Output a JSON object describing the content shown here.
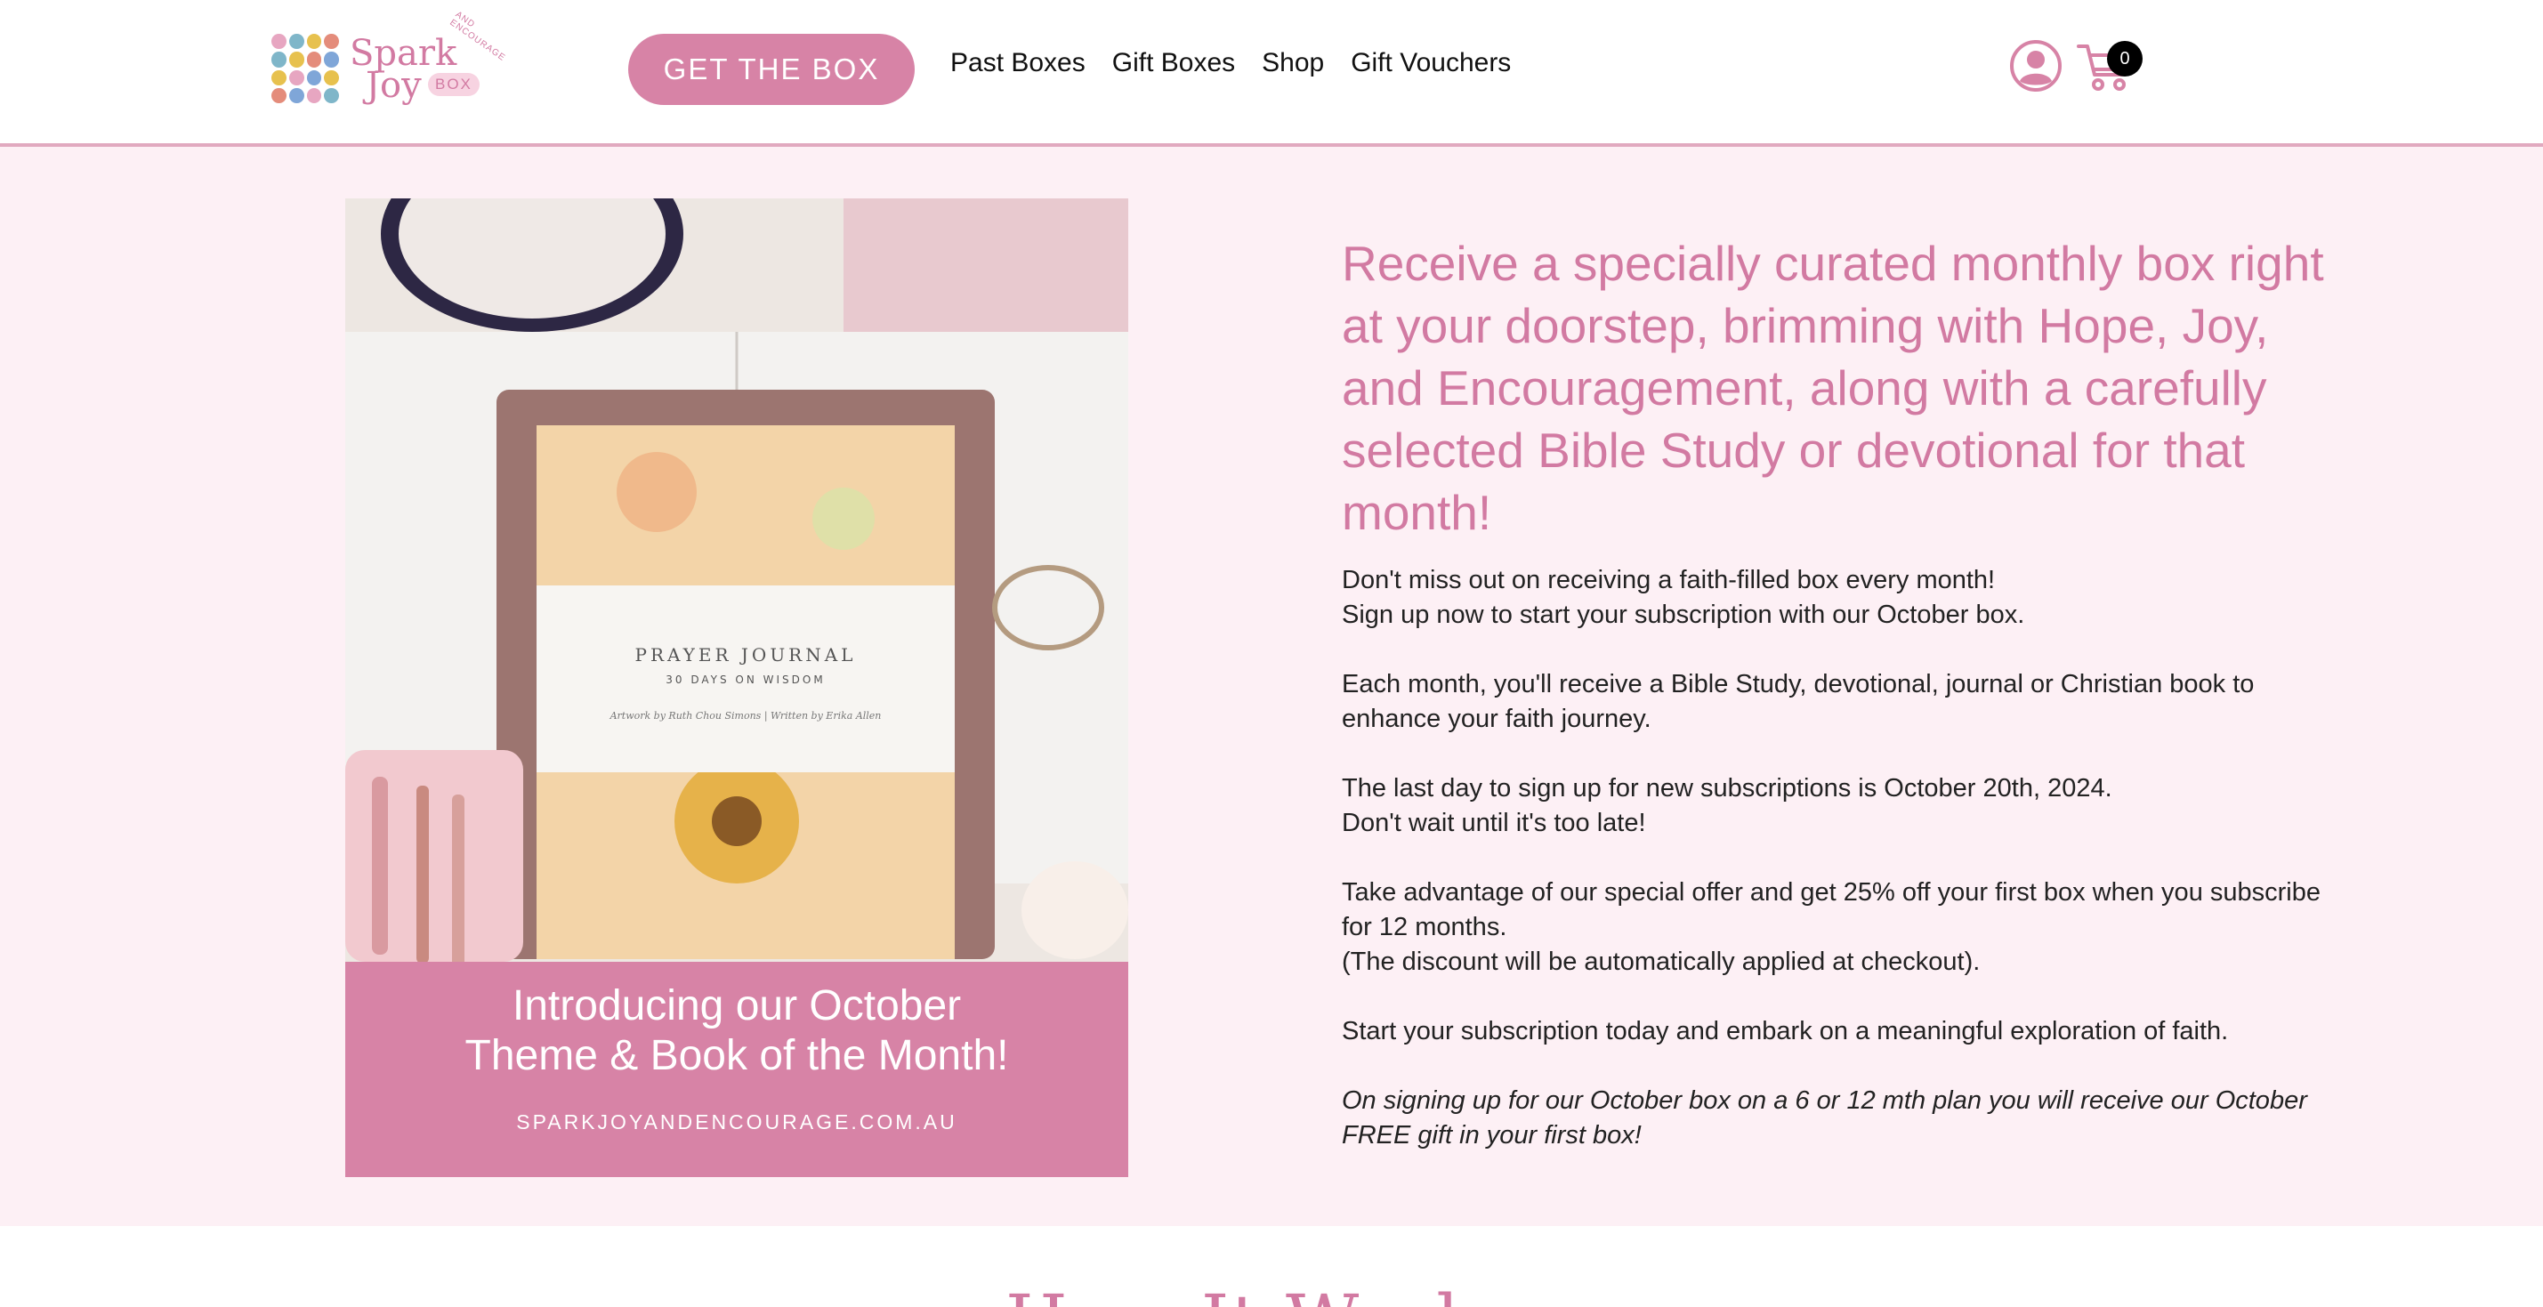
{
  "brand": {
    "logo_word1": "Spark",
    "logo_word2": "Joy",
    "logo_box": "BOX",
    "logo_tag": "AND ENCOURAGE",
    "accent_color": "#d783a6",
    "headline_color": "#d27aa2",
    "hero_bg": "#fdf0f5"
  },
  "header": {
    "cta_label": "GET THE BOX",
    "nav": [
      "Past Boxes",
      "Gift Boxes",
      "Shop",
      "Gift Vouchers"
    ],
    "user_icon": "user-circle-icon",
    "cart_icon": "shopping-cart-icon",
    "cart_count": "0"
  },
  "promo": {
    "title_line1": "Introducing our October",
    "title_line2": "Theme & Book of the Month!",
    "url": "SPARKJOYANDENCOURAGE.COM.AU",
    "journal_title": "PRAYER JOURNAL",
    "journal_subtitle": "30 DAYS ON WISDOM",
    "journal_credit": "Artwork by Ruth Chou Simons | Written by Erika Allen"
  },
  "content": {
    "headline": "Receive a specially curated monthly box right at your doorstep, brimming with Hope, Joy, and Encouragement, along with a carefully selected Bible Study or devotional for that month!",
    "p1_line1": "Don't miss out on receiving a faith-filled box every month!",
    "p1_line2": "Sign up now to start your subscription with our October box.",
    "p2": "Each month, you'll receive a Bible Study, devotional, journal or Christian book to enhance your faith journey.",
    "p3_line1": "The last day to sign up for new subscriptions is October 20th, 2024.",
    "p3_line2": "Don't wait until it's too late!",
    "p4_line1": "Take advantage of our special offer and get 25% off your first box when you subscribe for 12 months.",
    "p4_line2": "(The discount will be automatically applied at checkout).",
    "p5": "Start your subscription today and embark on a meaningful exploration of faith.",
    "p6": "On signing up for our October box on a 6 or 12 mth plan you will receive our October FREE gift in your first box!"
  },
  "how_it_works": {
    "title": "How It Works"
  }
}
